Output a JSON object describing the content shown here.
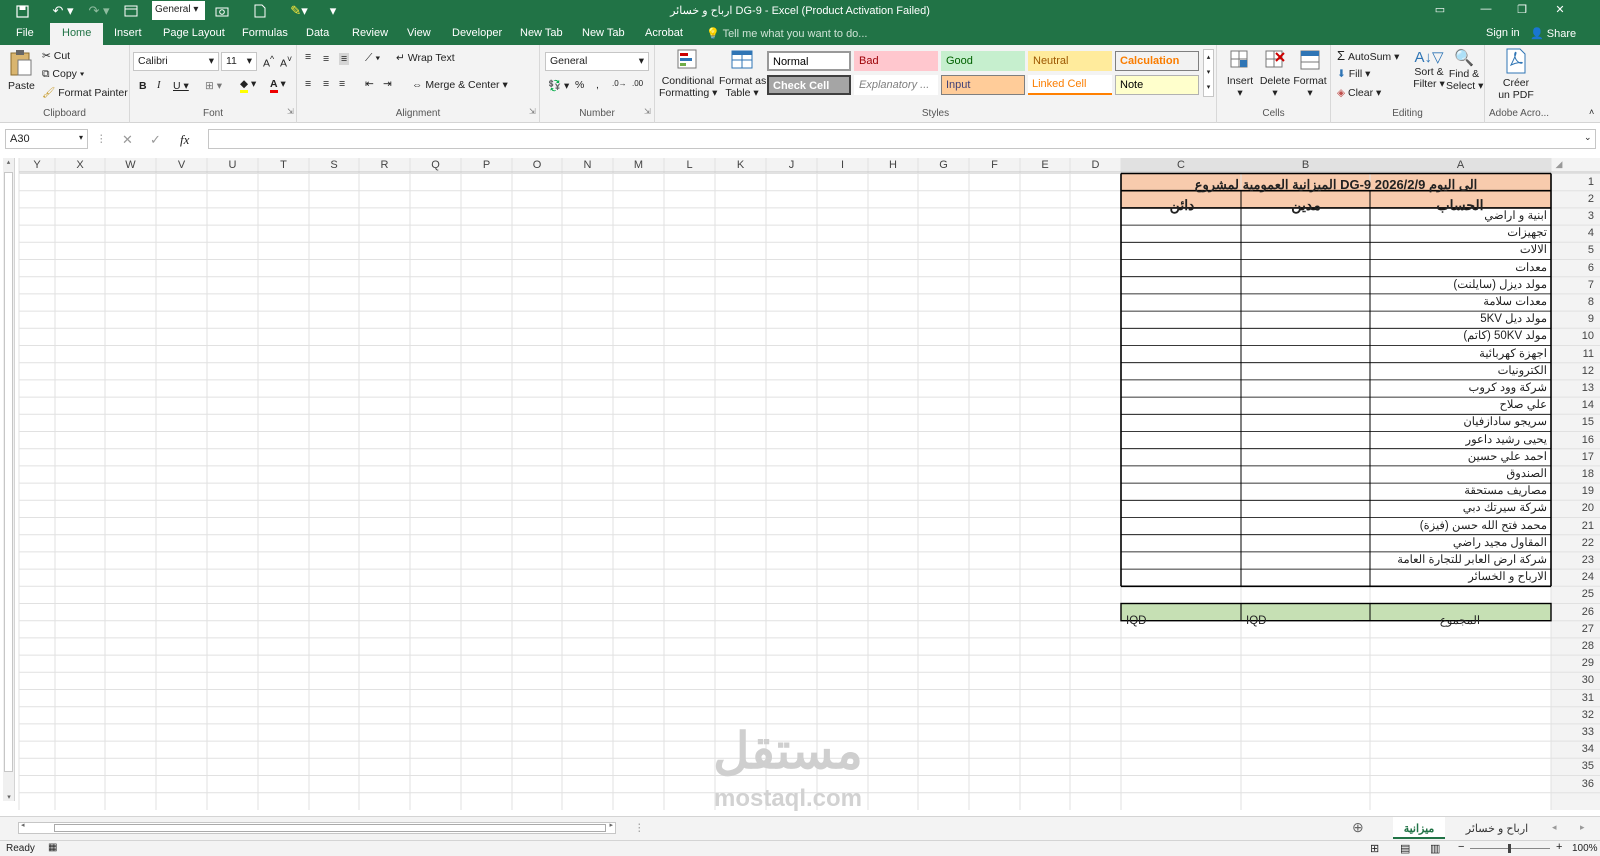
{
  "titlebar": {
    "font_box": "General",
    "window_title": "ارباح و خسائر DG-9 - Excel (Product Activation Failed)"
  },
  "tabs": [
    {
      "label": "File"
    },
    {
      "label": "Home"
    },
    {
      "label": "Insert"
    },
    {
      "label": "Page Layout"
    },
    {
      "label": "Formulas"
    },
    {
      "label": "Data"
    },
    {
      "label": "Review"
    },
    {
      "label": "View"
    },
    {
      "label": "Developer"
    },
    {
      "label": "New Tab"
    },
    {
      "label": "New Tab"
    },
    {
      "label": "Acrobat"
    }
  ],
  "tell_me": "Tell me what you want to do...",
  "account": {
    "sign_in": "Sign in",
    "share": "Share"
  },
  "ribbon": {
    "clipboard": {
      "paste": "Paste",
      "cut": "Cut",
      "copy": "Copy",
      "format_painter": "Format Painter",
      "label": "Clipboard"
    },
    "font": {
      "name": "Calibri",
      "size": "11",
      "label": "Font"
    },
    "alignment": {
      "wrap": "Wrap Text",
      "merge": "Merge & Center",
      "label": "Alignment"
    },
    "number": {
      "format": "General",
      "label": "Number"
    },
    "styles": {
      "cond_1": "Conditional",
      "cond_2": "Formatting",
      "fmt_1": "Format as",
      "fmt_2": "Table",
      "normal": "Normal",
      "bad": "Bad",
      "good": "Good",
      "neutral": "Neutral",
      "calculation": "Calculation",
      "check": "Check Cell",
      "explanatory": "Explanatory ...",
      "input": "Input",
      "linked": "Linked Cell",
      "note": "Note",
      "label": "Styles"
    },
    "cells": {
      "insert": "Insert",
      "delete": "Delete",
      "format": "Format",
      "label": "Cells"
    },
    "editing": {
      "autosum": "AutoSum",
      "fill": "Fill",
      "clear": "Clear",
      "sort_1": "Sort &",
      "sort_2": "Filter",
      "find_1": "Find &",
      "find_2": "Select",
      "label": "Editing"
    },
    "acrobat": {
      "c1": "Créer",
      "c2": "un PDF",
      "label": "Adobe Acro..."
    }
  },
  "formula": {
    "namebox": "A30",
    "value": ""
  },
  "columns": [
    "Y",
    "X",
    "W",
    "V",
    "U",
    "T",
    "S",
    "R",
    "Q",
    "P",
    "O",
    "N",
    "M",
    "L",
    "K",
    "J",
    "I",
    "H",
    "G",
    "F",
    "E",
    "D",
    "C",
    "B",
    "A"
  ],
  "sheet": {
    "title": "الميزانية العمومية لمشروع DG-9 الى اليوم 2026/2/9",
    "header": {
      "account": "الحساب",
      "debit": "مدين",
      "credit": "دائن"
    },
    "accounts": [
      "ابنية و اراضي",
      "تجهيزات",
      "الالات",
      "معدات",
      "مولد ديزل (سايلنت)",
      "معدات سلامة",
      "مولد ديل 5KV",
      "مولد 50KV (كاتم)",
      "اجهزة كهربائية",
      "الكترونيات",
      "شركة وود كروب",
      "علي صلاح",
      "سريجو سادازفيان",
      "يحيى رشيد داعور",
      "احمد علي حسين",
      "الصندوق",
      "مصاريف مستحقة",
      "شركة سيرتك دبي",
      "محمد فتح الله حسن (فيزة)",
      "المقاول مجيد راضي",
      "شركة ارض العابر للتجارة العامة",
      "الارباح و الخسائر"
    ],
    "total_label": "المجموع",
    "currency": "IQD",
    "total_debit": "-",
    "total_credit": "-"
  },
  "sheet_tabs": [
    {
      "label": "ميزانية"
    },
    {
      "label": "ارباح و خسائر"
    }
  ],
  "status": {
    "ready": "Ready",
    "zoom": "100%"
  },
  "watermark": {
    "arabic": "مستقل",
    "latin": "mostaql.com"
  }
}
